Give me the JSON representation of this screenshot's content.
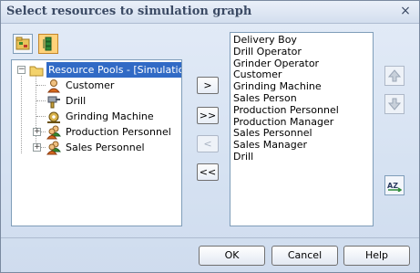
{
  "window": {
    "title": "Select resources to simulation graph"
  },
  "tree": {
    "root": {
      "label": "Resource Pools - [Simulation E:",
      "expander": "−"
    },
    "children": [
      {
        "label": "Customer",
        "icon": "person-icon",
        "expander": ""
      },
      {
        "label": "Drill",
        "icon": "machine-icon",
        "expander": ""
      },
      {
        "label": "Grinding Machine",
        "icon": "machine-icon",
        "expander": ""
      },
      {
        "label": "Production Personnel",
        "icon": "group-icon",
        "expander": "+"
      },
      {
        "label": "Sales Personnel",
        "icon": "group-icon",
        "expander": "+"
      }
    ]
  },
  "transfer_buttons": {
    "add_label": ">",
    "add_all_label": ">>",
    "remove_label": "<",
    "remove_all_label": "<<"
  },
  "selected_list": {
    "items": [
      "Delivery Boy",
      "Drill Operator",
      "Grinder Operator",
      "Customer",
      "Grinding Machine",
      "Sales Person",
      "Production Personnel",
      "Production Manager",
      "Sales Personnel",
      "Sales Manager",
      "Drill"
    ]
  },
  "footer": {
    "ok_label": "OK",
    "cancel_label": "Cancel",
    "help_label": "Help"
  },
  "close_glyph": "×",
  "colors": {
    "selection": "#316ac5",
    "active_tool": "#ffd27a"
  }
}
